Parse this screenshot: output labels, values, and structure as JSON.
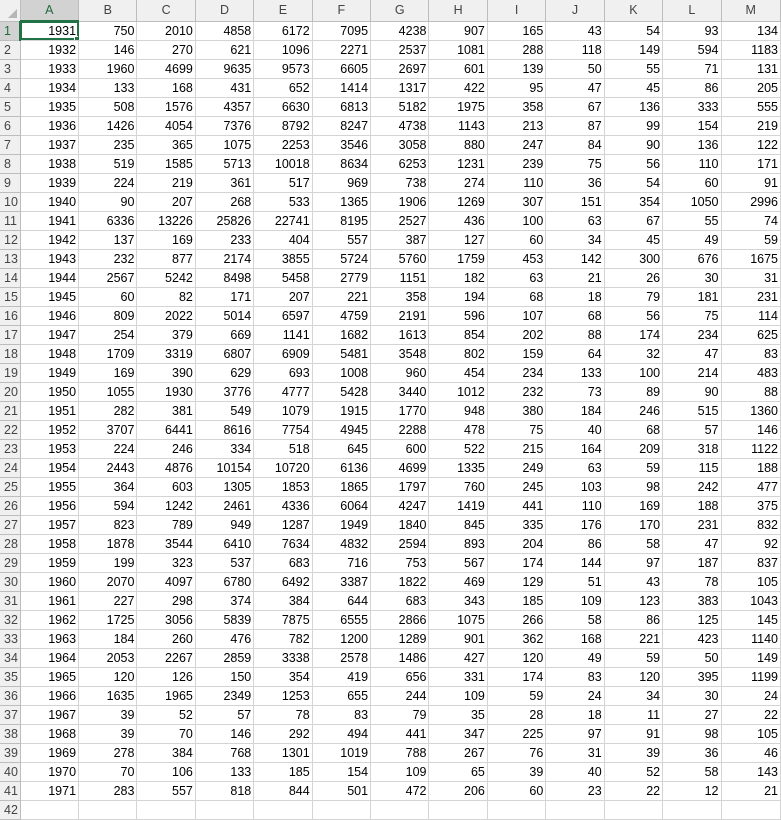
{
  "columns": [
    "A",
    "B",
    "C",
    "D",
    "E",
    "F",
    "G",
    "H",
    "I",
    "J",
    "K",
    "L",
    "M"
  ],
  "active_cell": {
    "row": 1,
    "col": "A"
  },
  "accent_color": "#217346",
  "rows": [
    [
      "1931",
      "750",
      "2010",
      "4858",
      "6172",
      "7095",
      "4238",
      "907",
      "165",
      "43",
      "54",
      "93",
      "134"
    ],
    [
      "1932",
      "146",
      "270",
      "621",
      "1096",
      "2271",
      "2537",
      "1081",
      "288",
      "118",
      "149",
      "594",
      "1183"
    ],
    [
      "1933",
      "1960",
      "4699",
      "9635",
      "9573",
      "6605",
      "2697",
      "601",
      "139",
      "50",
      "55",
      "71",
      "131"
    ],
    [
      "1934",
      "133",
      "168",
      "431",
      "652",
      "1414",
      "1317",
      "422",
      "95",
      "47",
      "45",
      "86",
      "205"
    ],
    [
      "1935",
      "508",
      "1576",
      "4357",
      "6630",
      "6813",
      "5182",
      "1975",
      "358",
      "67",
      "136",
      "333",
      "555"
    ],
    [
      "1936",
      "1426",
      "4054",
      "7376",
      "8792",
      "8247",
      "4738",
      "1143",
      "213",
      "87",
      "99",
      "154",
      "219"
    ],
    [
      "1937",
      "235",
      "365",
      "1075",
      "2253",
      "3546",
      "3058",
      "880",
      "247",
      "84",
      "90",
      "136",
      "122"
    ],
    [
      "1938",
      "519",
      "1585",
      "5713",
      "10018",
      "8634",
      "6253",
      "1231",
      "239",
      "75",
      "56",
      "110",
      "171"
    ],
    [
      "1939",
      "224",
      "219",
      "361",
      "517",
      "969",
      "738",
      "274",
      "110",
      "36",
      "54",
      "60",
      "91"
    ],
    [
      "1940",
      "90",
      "207",
      "268",
      "533",
      "1365",
      "1906",
      "1269",
      "307",
      "151",
      "354",
      "1050",
      "2996"
    ],
    [
      "1941",
      "6336",
      "13226",
      "25826",
      "22741",
      "8195",
      "2527",
      "436",
      "100",
      "63",
      "67",
      "55",
      "74"
    ],
    [
      "1942",
      "137",
      "169",
      "233",
      "404",
      "557",
      "387",
      "127",
      "60",
      "34",
      "45",
      "49",
      "59"
    ],
    [
      "1943",
      "232",
      "877",
      "2174",
      "3855",
      "5724",
      "5760",
      "1759",
      "453",
      "142",
      "300",
      "676",
      "1675"
    ],
    [
      "1944",
      "2567",
      "5242",
      "8498",
      "5458",
      "2779",
      "1151",
      "182",
      "63",
      "21",
      "26",
      "30",
      "31"
    ],
    [
      "1945",
      "60",
      "82",
      "171",
      "207",
      "221",
      "358",
      "194",
      "68",
      "18",
      "79",
      "181",
      "231"
    ],
    [
      "1946",
      "809",
      "2022",
      "5014",
      "6597",
      "4759",
      "2191",
      "596",
      "107",
      "68",
      "56",
      "75",
      "114"
    ],
    [
      "1947",
      "254",
      "379",
      "669",
      "1141",
      "1682",
      "1613",
      "854",
      "202",
      "88",
      "174",
      "234",
      "625"
    ],
    [
      "1948",
      "1709",
      "3319",
      "6807",
      "6909",
      "5481",
      "3548",
      "802",
      "159",
      "64",
      "32",
      "47",
      "83"
    ],
    [
      "1949",
      "169",
      "390",
      "629",
      "693",
      "1008",
      "960",
      "454",
      "234",
      "133",
      "100",
      "214",
      "483"
    ],
    [
      "1950",
      "1055",
      "1930",
      "3776",
      "4777",
      "5428",
      "3440",
      "1012",
      "232",
      "73",
      "89",
      "90",
      "88"
    ],
    [
      "1951",
      "282",
      "381",
      "549",
      "1079",
      "1915",
      "1770",
      "948",
      "380",
      "184",
      "246",
      "515",
      "1360"
    ],
    [
      "1952",
      "3707",
      "6441",
      "8616",
      "7754",
      "4945",
      "2288",
      "478",
      "75",
      "40",
      "68",
      "57",
      "146"
    ],
    [
      "1953",
      "224",
      "246",
      "334",
      "518",
      "645",
      "600",
      "522",
      "215",
      "164",
      "209",
      "318",
      "1122"
    ],
    [
      "1954",
      "2443",
      "4876",
      "10154",
      "10720",
      "6136",
      "4699",
      "1335",
      "249",
      "63",
      "59",
      "115",
      "188"
    ],
    [
      "1955",
      "364",
      "603",
      "1305",
      "1853",
      "1865",
      "1797",
      "760",
      "245",
      "103",
      "98",
      "242",
      "477"
    ],
    [
      "1956",
      "594",
      "1242",
      "2461",
      "4336",
      "6064",
      "4247",
      "1419",
      "441",
      "110",
      "169",
      "188",
      "375"
    ],
    [
      "1957",
      "823",
      "789",
      "949",
      "1287",
      "1949",
      "1840",
      "845",
      "335",
      "176",
      "170",
      "231",
      "832"
    ],
    [
      "1958",
      "1878",
      "3544",
      "6410",
      "7634",
      "4832",
      "2594",
      "893",
      "204",
      "86",
      "58",
      "47",
      "92"
    ],
    [
      "1959",
      "199",
      "323",
      "537",
      "683",
      "716",
      "753",
      "567",
      "174",
      "144",
      "97",
      "187",
      "837"
    ],
    [
      "1960",
      "2070",
      "4097",
      "6780",
      "6492",
      "3387",
      "1822",
      "469",
      "129",
      "51",
      "43",
      "78",
      "105"
    ],
    [
      "1961",
      "227",
      "298",
      "374",
      "384",
      "644",
      "683",
      "343",
      "185",
      "109",
      "123",
      "383",
      "1043"
    ],
    [
      "1962",
      "1725",
      "3056",
      "5839",
      "7875",
      "6555",
      "2866",
      "1075",
      "266",
      "58",
      "86",
      "125",
      "145"
    ],
    [
      "1963",
      "184",
      "260",
      "476",
      "782",
      "1200",
      "1289",
      "901",
      "362",
      "168",
      "221",
      "423",
      "1140"
    ],
    [
      "1964",
      "2053",
      "2267",
      "2859",
      "3338",
      "2578",
      "1486",
      "427",
      "120",
      "49",
      "59",
      "50",
      "149"
    ],
    [
      "1965",
      "120",
      "126",
      "150",
      "354",
      "419",
      "656",
      "331",
      "174",
      "83",
      "120",
      "395",
      "1199"
    ],
    [
      "1966",
      "1635",
      "1965",
      "2349",
      "1253",
      "655",
      "244",
      "109",
      "59",
      "24",
      "34",
      "30",
      "24"
    ],
    [
      "1967",
      "39",
      "52",
      "57",
      "78",
      "83",
      "79",
      "35",
      "28",
      "18",
      "11",
      "27",
      "22"
    ],
    [
      "1968",
      "39",
      "70",
      "146",
      "292",
      "494",
      "441",
      "347",
      "225",
      "97",
      "91",
      "98",
      "105"
    ],
    [
      "1969",
      "278",
      "384",
      "768",
      "1301",
      "1019",
      "788",
      "267",
      "76",
      "31",
      "39",
      "36",
      "46"
    ],
    [
      "1970",
      "70",
      "106",
      "133",
      "185",
      "154",
      "109",
      "65",
      "39",
      "40",
      "52",
      "58",
      "143"
    ],
    [
      "1971",
      "283",
      "557",
      "818",
      "844",
      "501",
      "472",
      "206",
      "60",
      "23",
      "22",
      "12",
      "21"
    ]
  ],
  "trailing_row_number": "42"
}
